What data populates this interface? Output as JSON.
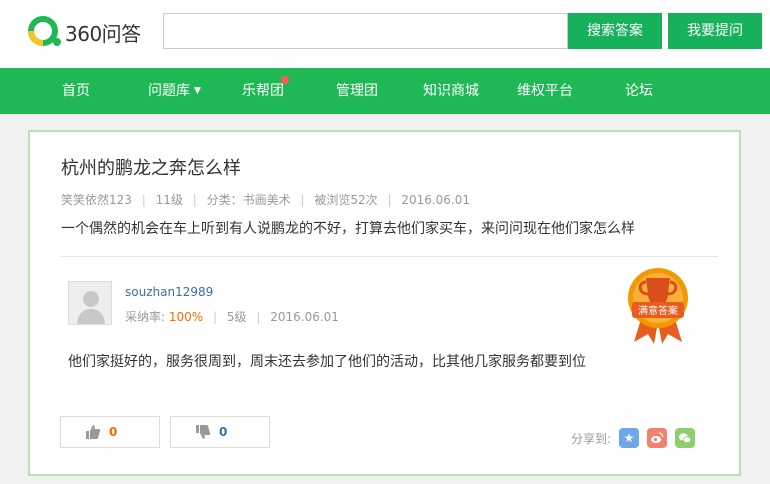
{
  "header": {
    "logo_text": "360问答",
    "search_placeholder": "",
    "search_button": "搜索答案",
    "ask_button": "我要提问"
  },
  "nav": {
    "items": [
      {
        "label": "首页"
      },
      {
        "label": "问题库"
      },
      {
        "label": "乐帮团"
      },
      {
        "label": "管理团"
      },
      {
        "label": "知识商城"
      },
      {
        "label": "维权平台"
      },
      {
        "label": "论坛"
      }
    ]
  },
  "question": {
    "title": "杭州的鹏龙之奔怎么样",
    "author": "笑笑依然123",
    "level": "11级",
    "category_label": "分类：",
    "category": "书画美术",
    "views": "被浏览52次",
    "date": "2016.06.01",
    "body": "一个偶然的机会在车上听到有人说鹏龙的不好，打算去他们家买车，来问问现在他们家怎么样"
  },
  "answer": {
    "username": "souzhan12989",
    "rate_label": "采纳率:",
    "rate": "100%",
    "level": "5级",
    "date": "2016.06.01",
    "badge_text": "满意答案",
    "body": "他们家挺好的，服务很周到，周末还去参加了他们的活动，比其他几家服务都要到位",
    "upvotes": "0",
    "downvotes": "0",
    "share_label": "分享到:"
  },
  "colors": {
    "brand_green": "#1fb854",
    "button_green": "#17b15c",
    "card_border": "#b9e1b1",
    "badge_orange": "#f39800",
    "link_blue": "#3b6ea5",
    "accent_orange": "#ff6600"
  }
}
